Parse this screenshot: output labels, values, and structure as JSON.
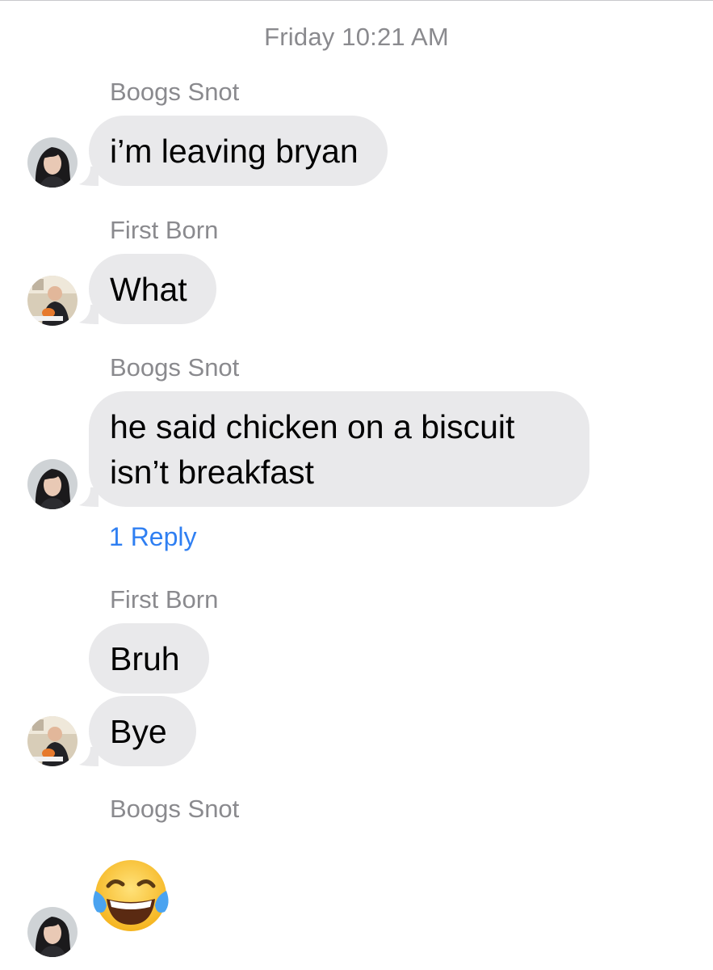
{
  "thread": {
    "timestamp": "Friday 10:21 AM"
  },
  "participants": {
    "a": {
      "name": "Boogs Snot",
      "avatar_icon": "profile-photo-dark-hair-icon"
    },
    "b": {
      "name": "First Born",
      "avatar_icon": "profile-photo-seated-person-icon"
    }
  },
  "messages": [
    {
      "sender": "Boogs Snot",
      "text": "i’m leaving bryan"
    },
    {
      "sender": "First Born",
      "text": "What"
    },
    {
      "sender": "Boogs Snot",
      "line1": "he said chicken on a biscuit",
      "line2": "isn’t breakfast",
      "reply_link": "1 Reply"
    },
    {
      "sender": "First Born",
      "text": "Bruh"
    },
    {
      "sender": "First Born",
      "text": "Bye"
    },
    {
      "sender": "Boogs Snot",
      "emoji_icon": "face-with-tears-of-joy-emoji-icon"
    }
  ],
  "colors": {
    "bubble": "#e9e9eb",
    "meta_text": "#8a8a8e",
    "link": "#2f7ff2",
    "message_text": "#000000"
  }
}
